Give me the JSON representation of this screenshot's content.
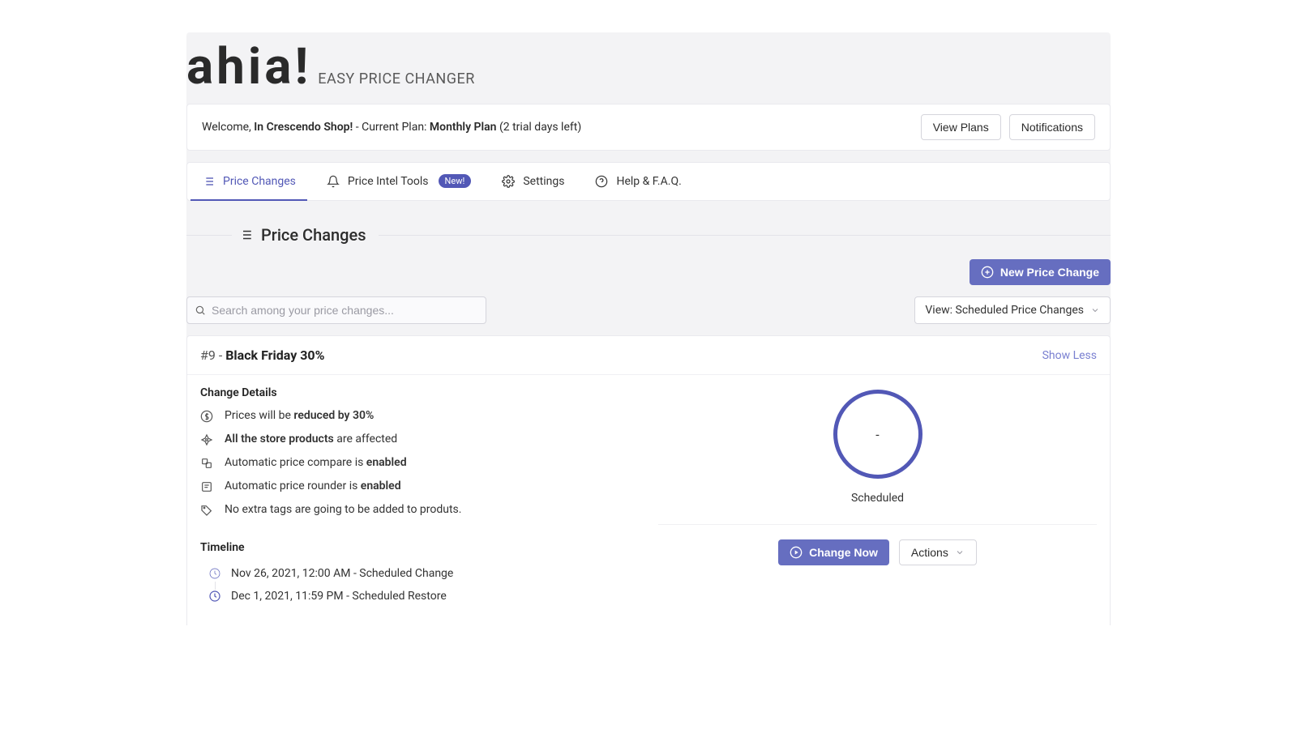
{
  "brand": {
    "title": "ahia!",
    "subtitle": "EASY PRICE CHANGER"
  },
  "welcome": {
    "prefix": "Welcome, ",
    "shop": "In Crescendo Shop!",
    "plan_label": " - Current Plan: ",
    "plan_name": "Monthly Plan",
    "trial": " (2 trial days left)",
    "view_plans": "View Plans",
    "notifications": "Notifications"
  },
  "tabs": {
    "price_changes": "Price Changes",
    "intel_tools": "Price Intel Tools",
    "intel_badge": "New!",
    "settings": "Settings",
    "help": "Help & F.A.Q."
  },
  "section": {
    "title": "Price Changes"
  },
  "actions": {
    "new_price_change": "New Price Change"
  },
  "search": {
    "placeholder": "Search among your price changes..."
  },
  "view_filter": {
    "label": "View: Scheduled Price Changes"
  },
  "item": {
    "id_prefix": "#9 - ",
    "name": "Black Friday 30%",
    "show_less": "Show Less",
    "details_heading": "Change Details",
    "details": {
      "l1_pre": "Prices will be ",
      "l1_strong": "reduced by 30%",
      "l2_strong": "All the store products",
      "l2_post": " are affected",
      "l3_pre": "Automatic price compare is ",
      "l3_strong": "enabled",
      "l4_pre": "Automatic price rounder is ",
      "l4_strong": "enabled",
      "l5": "No extra tags are going to be added to produts."
    },
    "timeline_heading": "Timeline",
    "timeline": {
      "t1": "Nov 26, 2021, 12:00 AM - Scheduled Change",
      "t2": "Dec 1, 2021, 11:59 PM - Scheduled Restore"
    },
    "status": {
      "ring_value": "-",
      "label": "Scheduled"
    },
    "buttons": {
      "change_now": "Change Now",
      "actions": "Actions"
    }
  }
}
